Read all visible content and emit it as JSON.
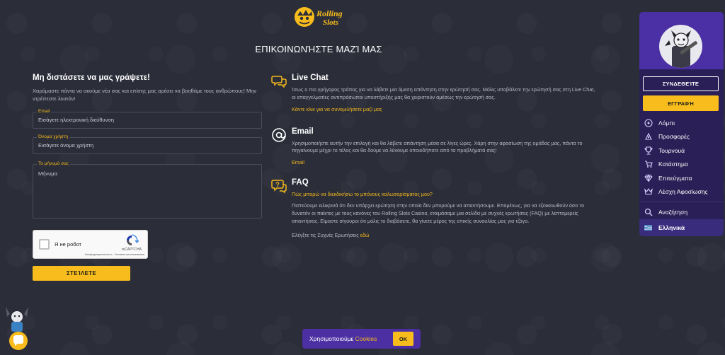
{
  "brand": {
    "logo_text": "Rolling Slots"
  },
  "page": {
    "title": "ΕΠΙΚΟΙΝΩΝΉΣΤΕ ΜΑΖΊ ΜΑΣ"
  },
  "form": {
    "heading": "Μη διστάσετε να μας γράψετε!",
    "subtitle": "Χαρόμαστε πάντα να ακούμε νέα σας και επίσης μας αρέσει να βοηθάμε τους ανθρώπους! Μην ντρέπεστε λοιπόν!",
    "email_label": "Email",
    "email_placeholder": "Εισάγετε ηλεκτρονική διεύθυνση",
    "username_label": "Όνομα χρήστη",
    "username_placeholder": "Εισάγετε όνομα χρήστη",
    "message_label": "Το μήνυμά σας",
    "message_placeholder": "Μήνυμα",
    "submit_label": "ΣΤΕΊΛΕΤΕ"
  },
  "recaptcha": {
    "label": "Я не робот",
    "brand": "reCAPTCHA",
    "links": "Конфиденциальность - Условия использования"
  },
  "contact": {
    "live_chat": {
      "title": "Live Chat",
      "text": "Ίσως ο πιο γρήγορος τρόπος για να λάβετε μια άμεση απάντηση στην ερώτησή σας. Μόλις υποβάλετε την ερώτησή σας στη Live Chat, οι επαγγελματίες αντιπρόσωποι υποστήριξής μας θα χειριστούν αμέσως την ερώτησή σας.",
      "link": "Κάντε κλικ για να συνομιλήσετε μαζί μας"
    },
    "email": {
      "title": "Email",
      "text": "Χρησιμοποιήστε αυτήν την επιλογή και θα λάβετε απάντηση μέσα σε λίγες ώρες. Χάρη στην αφοσίωση της ομάδας μας, πάντα το πηγαίνουμε μέχρι το τέλος και θα δούμε να λύνουμε οποιοδήποτε από τα προβλήματά σας!",
      "link": "Email"
    },
    "faq": {
      "title": "FAQ",
      "question": "Πώς μπορώ να διεκδικήσω το μπόνους καλωσορίσματος μου?",
      "text": "Πιστεύουμε ειλικρινά ότι δεν υπάρχει ερώτηση στην οποία δεν μπορούμε να απαντήσουμε. Επομένως, για να εξοικειωθούν όσο το δυνατόν οι παίκτες με τους κανόνες του Rolling Slots Casino, ετοιμάσαμε μια σελίδα με συχνές ερωτήσεις (FAQ) με λεπτομερείς απαντήσεις. Είμαστε σίγουροι ότι μόλις το διαβάσετε, θα γίνετε μέρος της επικής συναυλίας μας για τζόγο.",
      "footer_text": "Ελέγξτε τις Συχνές Ερωτήσεις",
      "footer_link": "εδώ"
    }
  },
  "side_menu": {
    "login_label": "ΣΥΝΔΕΘΕΊΤΕ",
    "register_label": "ΕΓΓΡΑΦΉ",
    "items": [
      {
        "label": "Λόμπι",
        "icon": "lobby-icon"
      },
      {
        "label": "Προσφορές",
        "icon": "promotions-icon"
      },
      {
        "label": "Τουρνουά",
        "icon": "tournaments-icon"
      },
      {
        "label": "Κατάστημα",
        "icon": "shop-icon"
      },
      {
        "label": "Επιτεύγματα",
        "icon": "achievements-icon"
      },
      {
        "label": "Λέσχη Αφοσίωσης",
        "icon": "loyalty-icon"
      }
    ],
    "search_label": "Αναζήτηση",
    "language_label": "Ελληνικά"
  },
  "cookies": {
    "text": "Χρησιμοποιούμε",
    "link": "Cookies",
    "ok_label": "OK"
  },
  "colors": {
    "background": "#2b2d39",
    "accent": "#f8bd1c",
    "menu_bg": "#2a1f56",
    "menu_header": "#4a2fa5"
  }
}
